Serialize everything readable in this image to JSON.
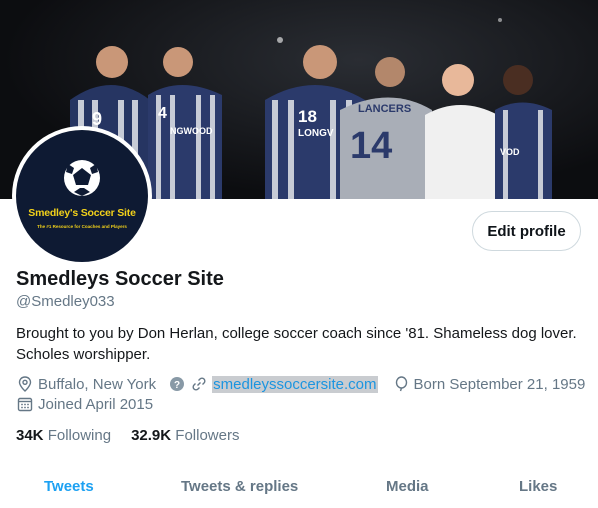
{
  "profile": {
    "display_name": "Smedleys Soccer Site",
    "handle": "@Smedley033",
    "bio": "Brought to you by Don Herlan, college soccer coach since '81. Shameless dog lover. Scholes worshipper.",
    "location": "Buffalo, New York",
    "website": "smedleyssoccersite.com",
    "birth": "Born September 21, 1959",
    "joined": "Joined April 2015",
    "edit_label": "Edit profile"
  },
  "avatar": {
    "name": "Smedley's Soccer Site",
    "tagline": "The #1 Resource for Coaches and Players"
  },
  "banner": {
    "jersey_numbers": [
      "9",
      "4",
      "18",
      "14"
    ],
    "jersey_texts": [
      "NGWOOD",
      "LONGV",
      "LANCERS",
      "VOD"
    ]
  },
  "stats": {
    "following_count": "34K",
    "following_label": "Following",
    "followers_count": "32.9K",
    "followers_label": "Followers"
  },
  "tabs": [
    "Tweets",
    "Tweets & replies",
    "Media",
    "Likes"
  ],
  "colors": {
    "accent": "#1da1f2",
    "link": "#1b95e0",
    "muted": "#657786"
  }
}
